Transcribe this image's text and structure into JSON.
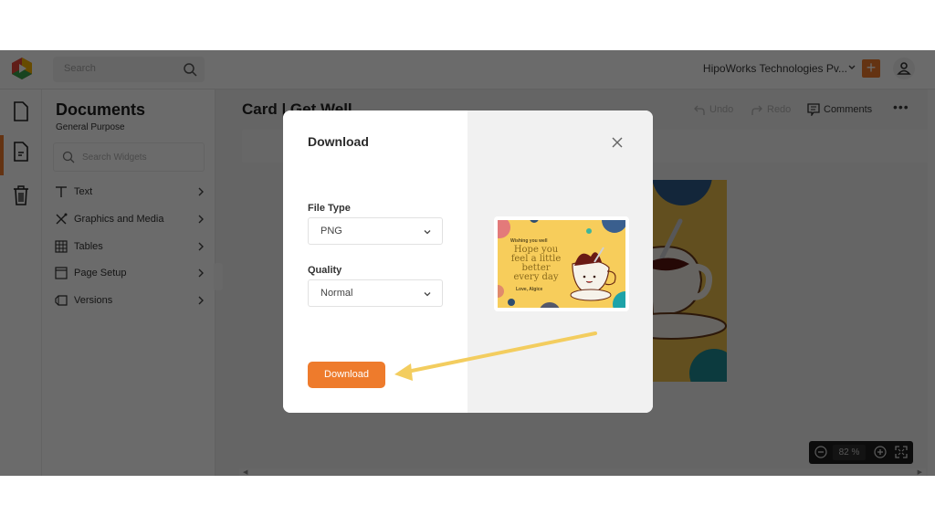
{
  "topbar": {
    "search_placeholder": "Search",
    "org_name": "HipoWorks Technologies Pv...",
    "add_label": "+"
  },
  "rail": {
    "items": [
      {
        "icon": "file-icon",
        "active": false
      },
      {
        "icon": "document-icon",
        "active": true
      },
      {
        "icon": "trash-icon",
        "active": false
      }
    ]
  },
  "panel": {
    "title": "Documents",
    "subtitle": "General Purpose",
    "search_placeholder": "Search Widgets",
    "items": [
      {
        "label": "Text",
        "icon": "text-icon"
      },
      {
        "label": "Graphics and Media",
        "icon": "graphics-icon"
      },
      {
        "label": "Tables",
        "icon": "table-icon"
      },
      {
        "label": "Page Setup",
        "icon": "page-setup-icon"
      },
      {
        "label": "Versions",
        "icon": "versions-icon"
      }
    ]
  },
  "editor": {
    "doc_title": "Card | Get Well",
    "toolbar": {
      "undo": "Undo",
      "redo": "Redo",
      "comments": "Comments",
      "more": "•••"
    },
    "zoom": {
      "value": "82",
      "unit": "%"
    }
  },
  "modal": {
    "title": "Download",
    "file_type_label": "File Type",
    "file_type_value": "PNG",
    "quality_label": "Quality",
    "quality_value": "Normal",
    "download_label": "Download",
    "preview": {
      "wishing": "Wishing you well",
      "message": "Hope you feel a little better every day",
      "signoff": "Love, Algice"
    }
  },
  "colors": {
    "accent": "#ee7b2c",
    "arrow": "#f3cd5f",
    "card_bg": "#f7cd5b"
  }
}
